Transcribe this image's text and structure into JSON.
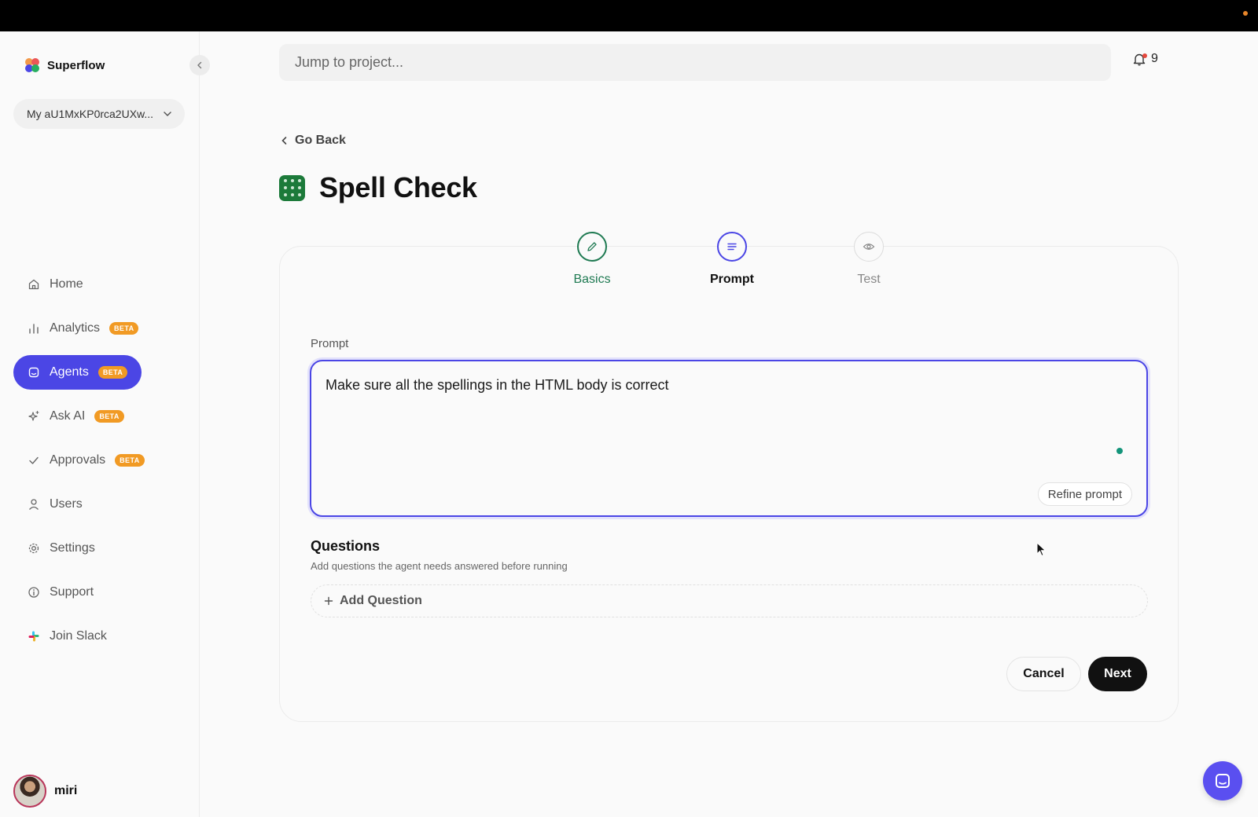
{
  "app": {
    "name": "Superflow"
  },
  "workspace": {
    "name": "My aU1MxKP0rca2UXw..."
  },
  "nav": {
    "items": [
      {
        "label": "Home",
        "icon": "home-icon",
        "badge": ""
      },
      {
        "label": "Analytics",
        "icon": "bar-chart-icon",
        "badge": "BETA"
      },
      {
        "label": "Agents",
        "icon": "agent-icon",
        "badge": "BETA",
        "active": true
      },
      {
        "label": "Ask AI",
        "icon": "sparkle-icon",
        "badge": "BETA"
      },
      {
        "label": "Approvals",
        "icon": "check-icon",
        "badge": "BETA"
      },
      {
        "label": "Users",
        "icon": "user-icon",
        "badge": ""
      },
      {
        "label": "Settings",
        "icon": "gear-icon",
        "badge": ""
      },
      {
        "label": "Support",
        "icon": "info-icon",
        "badge": ""
      },
      {
        "label": "Join Slack",
        "icon": "slack-icon",
        "badge": ""
      }
    ]
  },
  "user": {
    "name": "miri"
  },
  "search": {
    "placeholder": "Jump to project..."
  },
  "notifications": {
    "count": "9"
  },
  "page": {
    "back_label": "Go Back",
    "title": "Spell Check"
  },
  "steps": [
    {
      "label": "Basics",
      "state": "complete"
    },
    {
      "label": "Prompt",
      "state": "current"
    },
    {
      "label": "Test",
      "state": "upcoming"
    }
  ],
  "prompt": {
    "label": "Prompt",
    "value": "Make sure all the spellings in the HTML body is correct",
    "refine_label": "Refine prompt"
  },
  "questions": {
    "title": "Questions",
    "subtitle": "Add questions the agent needs answered before running",
    "add_label": "Add Question"
  },
  "actions": {
    "cancel_label": "Cancel",
    "next_label": "Next"
  },
  "colors": {
    "accent": "#4b46e5",
    "badge": "#f19a24",
    "success": "#1f7a52"
  }
}
